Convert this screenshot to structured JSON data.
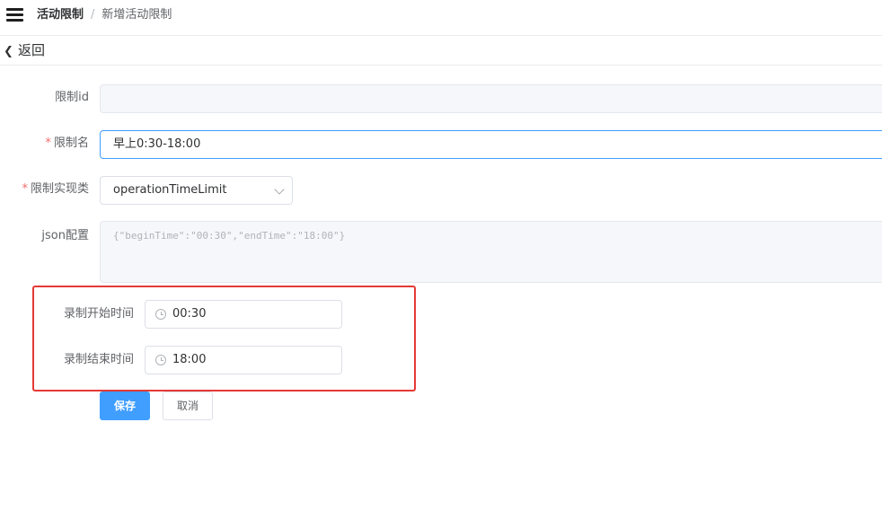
{
  "breadcrumb": {
    "first": "活动限制",
    "separator": "/",
    "current": "新增活动限制"
  },
  "back": {
    "label": "返回"
  },
  "form": {
    "limit_id": {
      "label": "限制id",
      "value": ""
    },
    "limit_name": {
      "label": "限制名",
      "required_mark": "*",
      "value": "早上0:30-18:00"
    },
    "limit_impl": {
      "label": "限制实现类",
      "required_mark": "*",
      "value": "operationTimeLimit"
    },
    "json_config": {
      "label": "json配置",
      "value": "{\"beginTime\":\"00:30\",\"endTime\":\"18:00\"}"
    },
    "start_time": {
      "label": "录制开始时间",
      "value": "00:30"
    },
    "end_time": {
      "label": "录制结束时间",
      "value": "18:00"
    }
  },
  "buttons": {
    "save": "保存",
    "cancel": "取消"
  },
  "colors": {
    "primary": "#409eff",
    "required": "#f56c6c",
    "highlight": "#e53935"
  }
}
